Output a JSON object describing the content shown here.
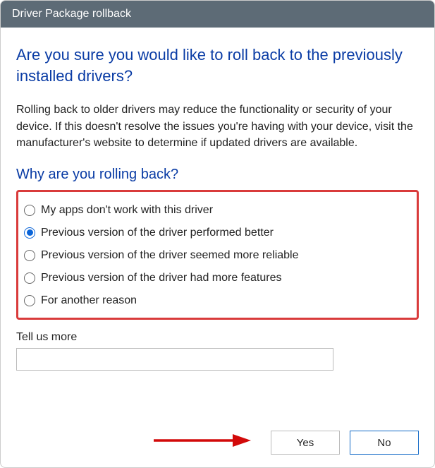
{
  "titlebar": {
    "title": "Driver Package rollback"
  },
  "heading": "Are you sure you would like to roll back to the previously installed drivers?",
  "body": "Rolling back to older drivers may reduce the functionality or security of your device.  If this doesn't resolve the issues you're having with your device, visit the manufacturer's website to determine if updated drivers are available.",
  "subheading": "Why are you rolling back?",
  "reasons": [
    {
      "label": "My apps don't work with this driver",
      "selected": false
    },
    {
      "label": "Previous version of the driver performed better",
      "selected": true
    },
    {
      "label": "Previous version of the driver seemed more reliable",
      "selected": false
    },
    {
      "label": "Previous version of the driver had more features",
      "selected": false
    },
    {
      "label": "For another reason",
      "selected": false
    }
  ],
  "tell_more": {
    "label": "Tell us more",
    "value": ""
  },
  "buttons": {
    "yes": "Yes",
    "no": "No"
  },
  "annotation": {
    "highlight_color": "#d93b3b",
    "arrow_color": "#d20a0a"
  }
}
